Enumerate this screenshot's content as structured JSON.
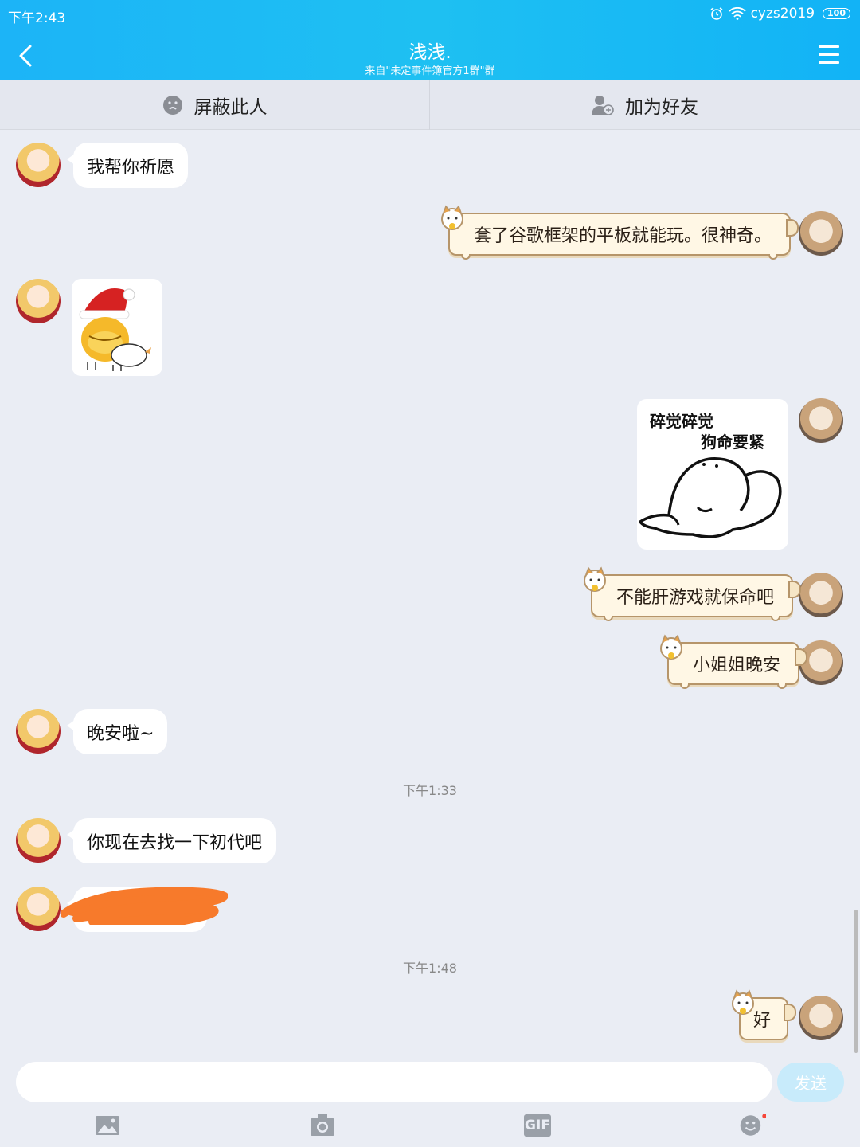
{
  "status_bar": {
    "time": "下午2:43",
    "carrier": "cyzs2019",
    "battery": "100"
  },
  "header": {
    "title": "浅浅.",
    "subtitle": "来自\"未定事件簿官方1群\"群"
  },
  "actions": {
    "block": "屏蔽此人",
    "add_friend": "加为好友"
  },
  "messages": {
    "m1": "我帮你祈愿",
    "m2": "套了谷歌框架的平板就能玩。很神奇。",
    "m4_line1": "碎觉碎觉",
    "m4_line2": "狗命要紧",
    "m5": "不能肝游戏就保命吧",
    "m6": "小姐姐晚安",
    "m7": "晚安啦~",
    "m8": "你现在去找一下初代吧",
    "m10": "好"
  },
  "timestamps": {
    "t1": "下午1:33",
    "t2": "下午1:48"
  },
  "composer": {
    "send_label": "发送",
    "gif_label": "GIF"
  }
}
